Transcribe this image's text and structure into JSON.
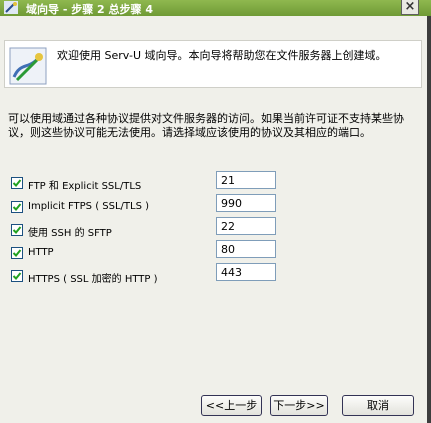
{
  "window": {
    "title": "域向导 - 步骤 2 总步骤 4",
    "close_glyph": "×"
  },
  "banner": {
    "text": "欢迎使用 Serv-U 域向导。本向导将帮助您在文件服务器上创建域。",
    "icon": "wizard-icon"
  },
  "description": "可以使用域通过各种协议提供对文件服务器的访问。如果当前许可证不支持某些协议，则这些协议可能无法使用。请选择域应该使用的协议及其相应的端口。",
  "protocols": [
    {
      "label": "FTP 和 Explicit SSL/TLS",
      "checked": true,
      "port": "21"
    },
    {
      "label": "Implicit FTPS ( SSL/TLS )",
      "checked": true,
      "port": "990"
    },
    {
      "label": "使用 SSH 的 SFTP",
      "checked": true,
      "port": "22"
    },
    {
      "label": "HTTP",
      "checked": true,
      "port": "80"
    },
    {
      "label": "HTTPS ( SSL 加密的 HTTP )",
      "checked": true,
      "port": "443"
    }
  ],
  "buttons": {
    "back": "<<上一步",
    "next": "下一步>>",
    "cancel": "取消"
  },
  "colors": {
    "titlebar": "#7aa63f",
    "checkbox_border": "#1c5180",
    "checkmark": "#21a121"
  }
}
